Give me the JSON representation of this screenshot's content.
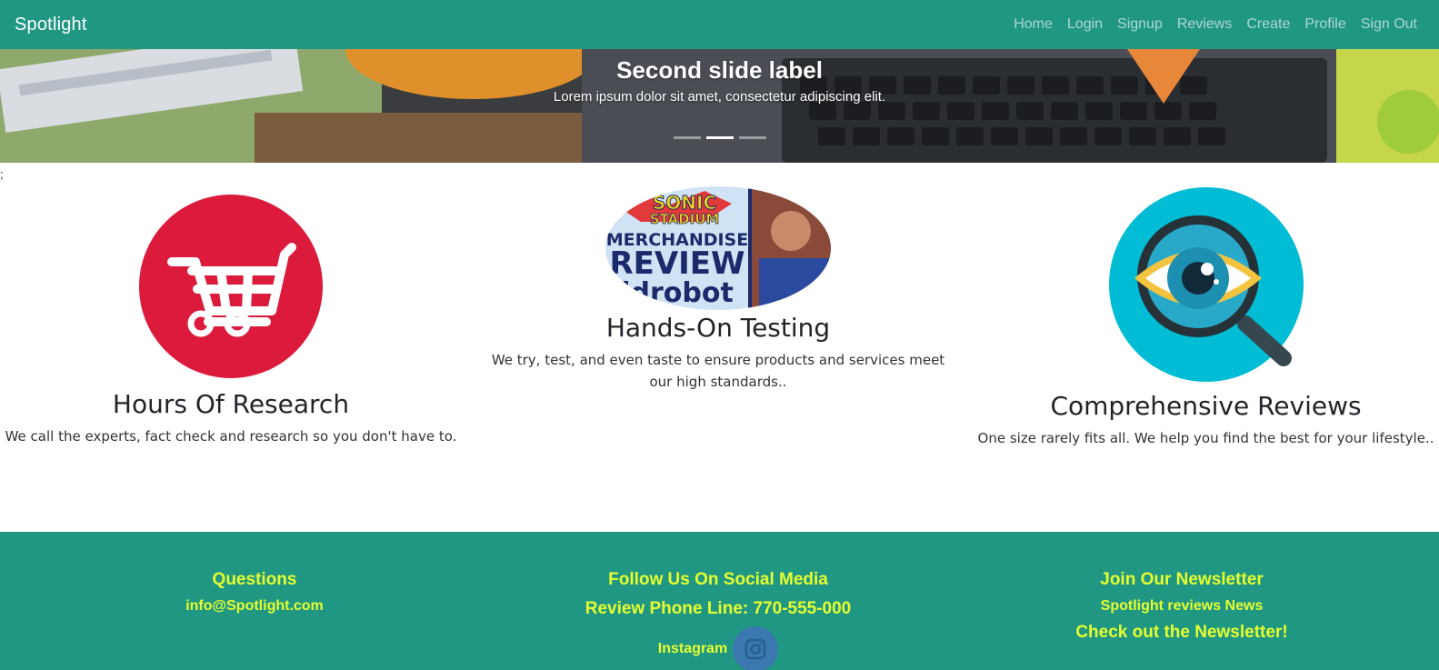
{
  "navbar": {
    "brand": "Spotlight",
    "links": [
      "Home",
      "Login",
      "Signup",
      "Reviews",
      "Create",
      "Profile",
      "Sign Out"
    ]
  },
  "carousel": {
    "slide_title": "Second slide label",
    "slide_text": "Lorem ipsum dolor sit amet, consectetur adipiscing elit.",
    "active_index": 1,
    "slide_count": 3
  },
  "stray_text": ";",
  "features": [
    {
      "title": "Hours Of Research",
      "text": "We call the experts, fact check and research so you don't have to.",
      "icon": "shopping-cart-icon"
    },
    {
      "title": "Hands-On Testing",
      "text": "We try, test, and even taste to ensure products and services meet our high standards..",
      "image_text": [
        "SONIC",
        "STADIUM",
        "MERCHANDISE",
        "REVIEW",
        "idrobot"
      ]
    },
    {
      "title": "Comprehensive Reviews",
      "text": "One size rarely fits all. We help you find the best for your lifestyle..",
      "icon": "magnifier-eye-icon"
    }
  ],
  "footer": {
    "questions_heading": "Questions",
    "email": "info@Spotlight.com",
    "social_heading": "Follow Us On Social Media",
    "phone": "Review Phone Line: 770-555-000",
    "instagram_label": "Instagram",
    "newsletter_heading": "Join Our Newsletter",
    "newsletter_sub": "Spotlight reviews News",
    "newsletter_link": "Check out the Newsletter!"
  },
  "colors": {
    "brand_green": "#209783",
    "footer_text": "#e6ff2e",
    "cart_red": "#dc1a3c",
    "eye_cyan": "#00bcd4",
    "instagram_blue": "#3b78b0"
  }
}
